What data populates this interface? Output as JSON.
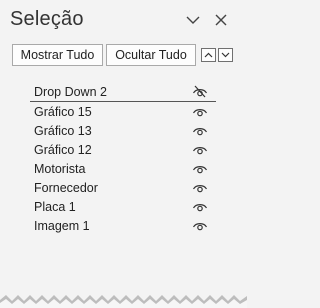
{
  "pane": {
    "title": "Seleção",
    "show_all_label": "Mostrar Tudo",
    "hide_all_label": "Ocultar Tudo"
  },
  "items": [
    {
      "label": "Drop Down 2",
      "visible": false,
      "selected": true
    },
    {
      "label": "Gráfico 15",
      "visible": true
    },
    {
      "label": "Gráfico 13",
      "visible": true
    },
    {
      "label": "Gráfico 12",
      "visible": true
    },
    {
      "label": "Motorista",
      "visible": true
    },
    {
      "label": "Fornecedor",
      "visible": true
    },
    {
      "label": "Placa 1",
      "visible": true
    },
    {
      "label": "Imagem 1",
      "visible": true
    }
  ],
  "icons": {
    "dropdown": "chevron-down-icon",
    "close": "close-icon",
    "up": "triangle-up-icon",
    "down": "triangle-down-icon",
    "visible": "eye-icon",
    "hidden": "eye-slash-icon"
  }
}
